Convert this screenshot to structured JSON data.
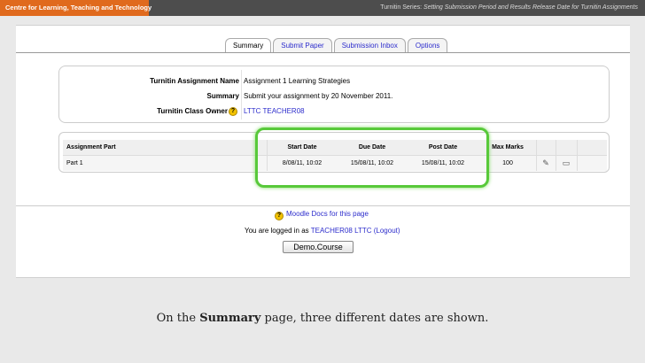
{
  "topbar": {
    "brand": "Centre for Learning, Teaching and Technology",
    "series_prefix": "Turnitin Series:",
    "series_title": "Setting Submission Period and Results Release Date for Turnitin Assignments",
    "brand_color": "#e06a1d"
  },
  "tabs": [
    {
      "label": "Summary",
      "active": true
    },
    {
      "label": "Submit Paper",
      "active": false
    },
    {
      "label": "Submission Inbox",
      "active": false
    },
    {
      "label": "Options",
      "active": false
    }
  ],
  "info": {
    "assignment_name_label": "Turnitin Assignment Name",
    "assignment_name_value": "Assignment 1 Learning Strategies",
    "summary_label": "Summary",
    "summary_value": "Submit your assignment by 20 November 2011.",
    "class_owner_label": "Turnitin Class Owner",
    "class_owner_value": "LTTC TEACHER08",
    "help_icon": "help-icon"
  },
  "table": {
    "headers": [
      "Assignment Part",
      "Start Date",
      "Due Date",
      "Post Date",
      "Max Marks"
    ],
    "row": {
      "part": "Part 1",
      "start_date": "8/08/11, 10:02",
      "due_date": "15/08/11, 10:02",
      "post_date": "15/08/11, 10:02",
      "max_marks": "100"
    },
    "highlight_color": "#58c93a"
  },
  "footer": {
    "moodle_docs": "Moodle Docs for this page",
    "logged_in_prefix": "You are logged in as",
    "user": "TEACHER08 LTTC",
    "logout": "(Logout)",
    "course_button": "Demo.Course"
  },
  "caption": {
    "prefix": "On the",
    "bold": "Summary",
    "suffix": "page, three different dates are shown."
  }
}
